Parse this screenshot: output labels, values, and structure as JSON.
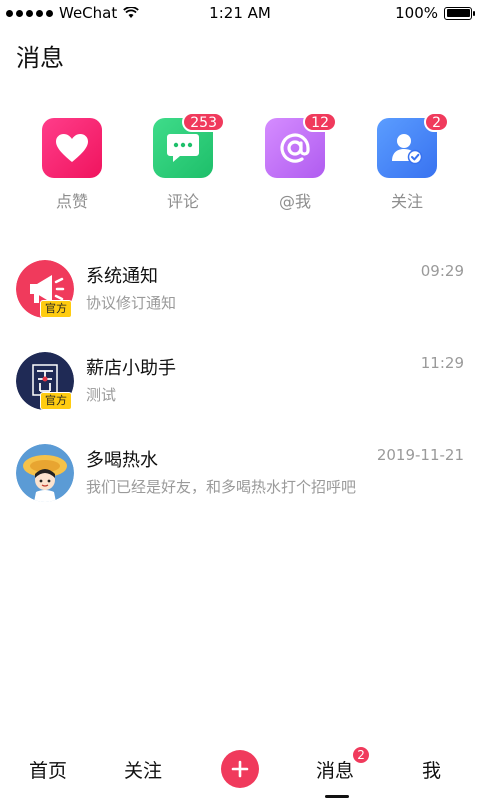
{
  "status_bar": {
    "carrier": "WeChat",
    "time": "1:21 AM",
    "battery": "100%",
    "battery_level": 1.0
  },
  "page": {
    "title": "消息"
  },
  "categories": [
    {
      "label": "点赞",
      "icon": "heart-icon",
      "badge": ""
    },
    {
      "label": "评论",
      "icon": "comment-icon",
      "badge": "253"
    },
    {
      "label": "@我",
      "icon": "at-icon",
      "badge": "12"
    },
    {
      "label": "关注",
      "icon": "user-check-icon",
      "badge": "2"
    }
  ],
  "messages": [
    {
      "name": "系统通知",
      "preview": "协议修订通知",
      "time": "09:29",
      "tag": "官方",
      "avatar": "megaphone-avatar"
    },
    {
      "name": "薪店小助手",
      "preview": "测试",
      "time": "11:29",
      "tag": "官方",
      "avatar": "shop-assistant-avatar"
    },
    {
      "name": "多喝热水",
      "preview": "我们已经是好友，和多喝热水打个招呼吧",
      "time": "2019-11-21",
      "tag": "",
      "avatar": "cartoon-avatar"
    }
  ],
  "tabbar": {
    "home": "首页",
    "follow": "关注",
    "messages": "消息",
    "messages_badge": "2",
    "me": "我",
    "active": "消息"
  },
  "colors": {
    "accent": "#f03a5c",
    "like": "#f0145e",
    "comment": "#1ebf6a",
    "at": "#b05cf0",
    "follow": "#3872f0",
    "official_tag": "#ffcc11"
  }
}
